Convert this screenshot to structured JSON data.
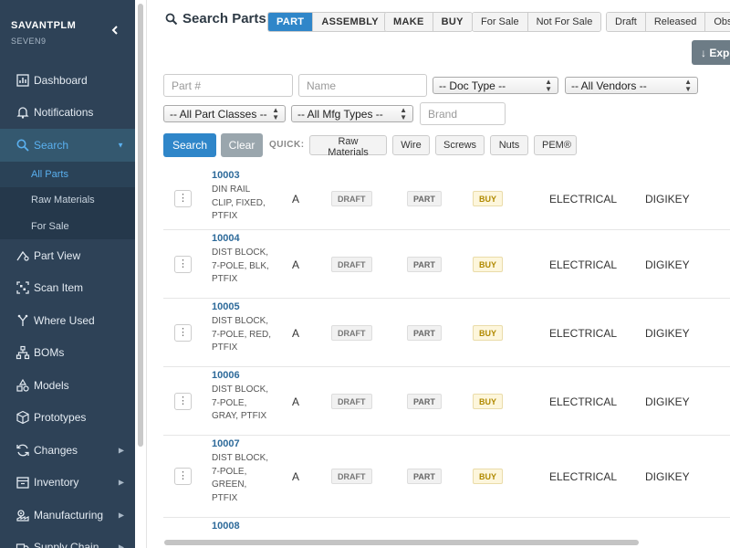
{
  "brand": {
    "name": "SAVANTPLM",
    "sub": "SEVEN9"
  },
  "sidebar": {
    "items": [
      {
        "label": "Dashboard",
        "icon": "dashboard-icon"
      },
      {
        "label": "Notifications",
        "icon": "bell-icon"
      },
      {
        "label": "Search",
        "icon": "search-icon",
        "active": true,
        "sub": [
          {
            "label": "All Parts",
            "current": true
          },
          {
            "label": "Raw Materials"
          },
          {
            "label": "For Sale"
          }
        ]
      },
      {
        "label": "Part View",
        "icon": "part-view-icon"
      },
      {
        "label": "Scan Item",
        "icon": "scan-icon"
      },
      {
        "label": "Where Used",
        "icon": "where-used-icon"
      },
      {
        "label": "BOMs",
        "icon": "bom-icon"
      },
      {
        "label": "Models",
        "icon": "models-icon"
      },
      {
        "label": "Prototypes",
        "icon": "cube-icon"
      },
      {
        "label": "Changes",
        "icon": "changes-icon",
        "arrow": true
      },
      {
        "label": "Inventory",
        "icon": "inventory-icon",
        "arrow": true
      },
      {
        "label": "Manufacturing",
        "icon": "manufacturing-icon",
        "arrow": true
      },
      {
        "label": "Supply Chain",
        "icon": "supply-chain-icon",
        "arrow": true
      }
    ]
  },
  "header": {
    "title": "Search Parts",
    "type_toggle": [
      "PART",
      "ASSEMBLY"
    ],
    "make_buy": [
      "MAKE",
      "BUY"
    ],
    "sale_toggle": [
      "For Sale",
      "Not For Sale"
    ],
    "status_toggle": [
      "Draft",
      "Released",
      "Obso"
    ],
    "export_label": "↓ Expo"
  },
  "filters": {
    "part_placeholder": "Part #",
    "name_placeholder": "Name",
    "doc_type": "-- Doc Type --",
    "vendors": "-- All Vendors --",
    "part_classes": "-- All Part Classes --",
    "mfg_types": "-- All Mfg Types --",
    "brand_placeholder": "Brand"
  },
  "actions": {
    "search": "Search",
    "clear": "Clear",
    "quick_label": "QUICK:"
  },
  "quick": [
    "Raw Materials",
    "Wire",
    "Screws",
    "Nuts",
    "PEM®"
  ],
  "rows": [
    {
      "num": "10003",
      "desc": [
        "DIN RAIL",
        "CLIP, FIXED,",
        "PTFIX"
      ],
      "rev": "A",
      "status": "DRAFT",
      "type": "PART",
      "source": "BUY",
      "class": "ELECTRICAL",
      "vendor": "DIGIKEY"
    },
    {
      "num": "10004",
      "desc": [
        "DIST BLOCK,",
        "7-POLE, BLK,",
        "PTFIX"
      ],
      "rev": "A",
      "status": "DRAFT",
      "type": "PART",
      "source": "BUY",
      "class": "ELECTRICAL",
      "vendor": "DIGIKEY"
    },
    {
      "num": "10005",
      "desc": [
        "DIST BLOCK,",
        "7-POLE, RED,",
        "PTFIX"
      ],
      "rev": "A",
      "status": "DRAFT",
      "type": "PART",
      "source": "BUY",
      "class": "ELECTRICAL",
      "vendor": "DIGIKEY"
    },
    {
      "num": "10006",
      "desc": [
        "DIST BLOCK,",
        "7-POLE,",
        "GRAY, PTFIX"
      ],
      "rev": "A",
      "status": "DRAFT",
      "type": "PART",
      "source": "BUY",
      "class": "ELECTRICAL",
      "vendor": "DIGIKEY"
    },
    {
      "num": "10007",
      "desc": [
        "DIST BLOCK,",
        "7-POLE,",
        "GREEN,",
        "PTFIX"
      ],
      "rev": "A",
      "status": "DRAFT",
      "type": "PART",
      "source": "BUY",
      "class": "ELECTRICAL",
      "vendor": "DIGIKEY"
    },
    {
      "num": "10008",
      "desc": [],
      "rev": "",
      "status": "",
      "type": "",
      "source": "",
      "class": "",
      "vendor": ""
    }
  ],
  "colors": {
    "sidebar_bg": "#2e4257",
    "accent": "#2f86c9",
    "link": "#2d6a9a",
    "buy_badge": "#b08900"
  }
}
